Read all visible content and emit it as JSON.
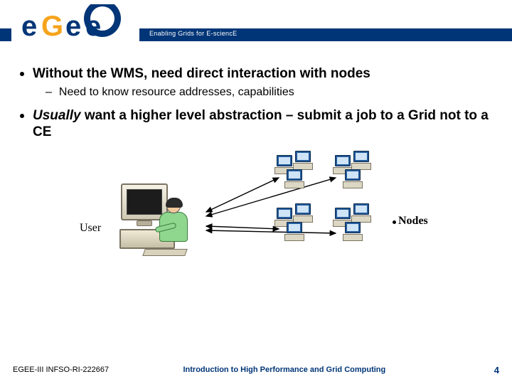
{
  "header": {
    "tagline": "Enabling Grids for E-sciencE",
    "logo_text": "eGee"
  },
  "bullets": {
    "b1": "Without the WMS, need direct interaction with nodes",
    "b1_sub": "Need to know resource addresses, capabilities",
    "b2_italic": "Usually",
    "b2_rest": " want a higher level abstraction – submit a job to a Grid not to a CE"
  },
  "diagram": {
    "user_label": "User",
    "nodes_label": "Nodes"
  },
  "footer": {
    "left": "EGEE-III INFSO-RI-222667",
    "center": "Introduction to High Performance and Grid Computing",
    "page": "4"
  }
}
